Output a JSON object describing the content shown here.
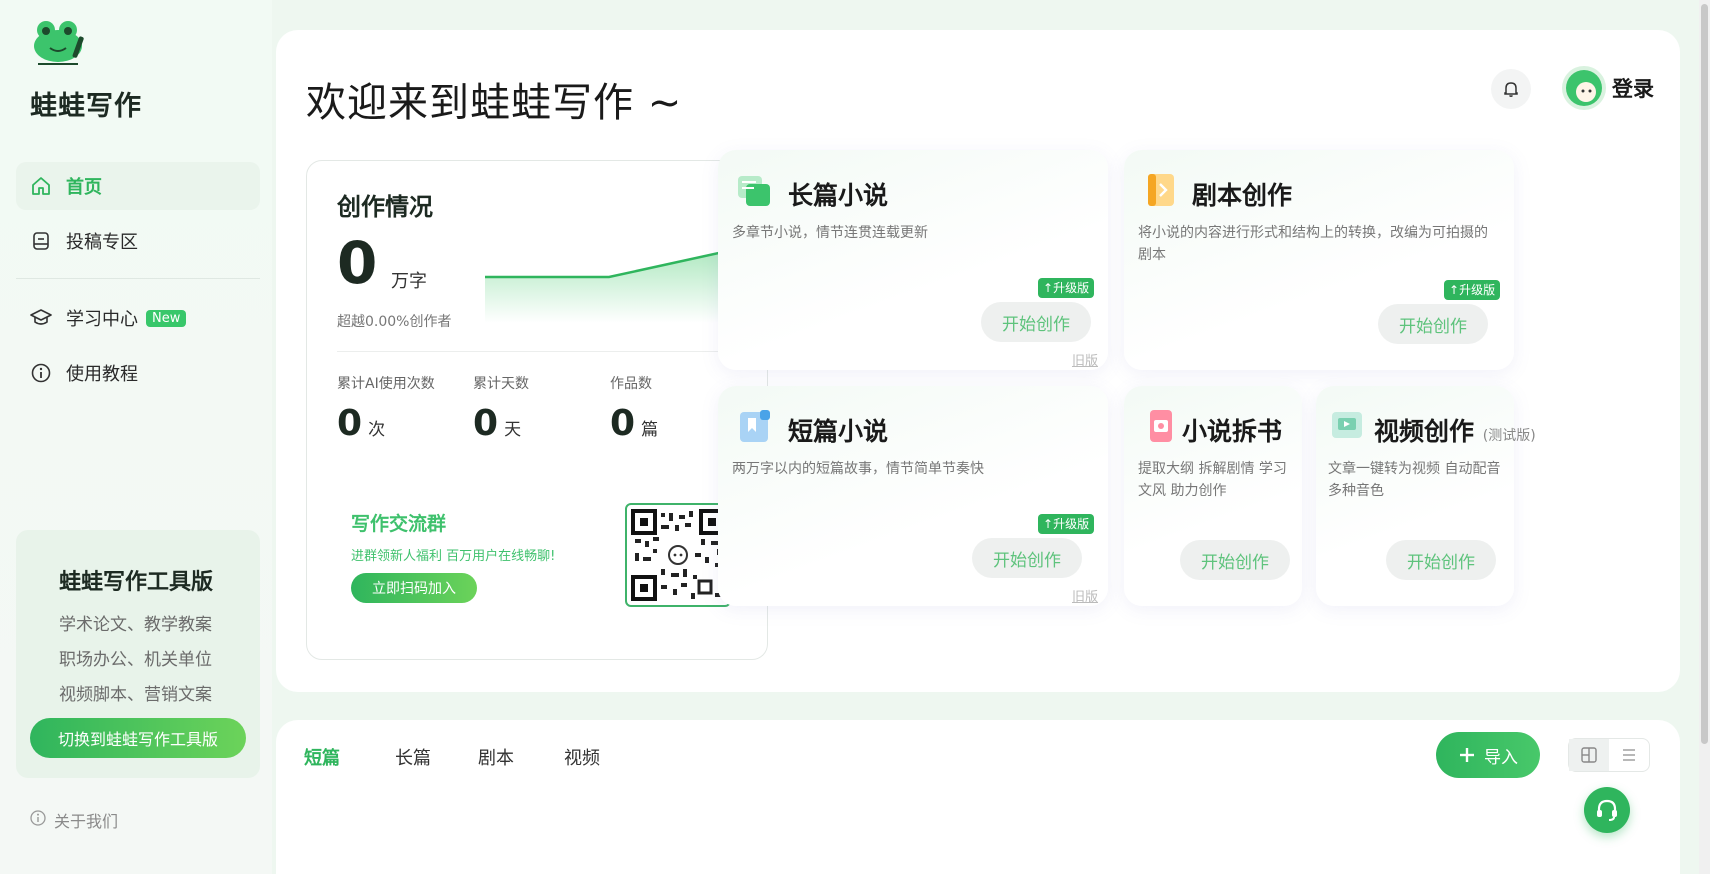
{
  "sidebar": {
    "brand": "蛙蛙写作",
    "nav": [
      {
        "label": "首页",
        "icon": "home-icon",
        "active": true
      },
      {
        "label": "投稿专区",
        "icon": "submission-icon"
      },
      {
        "label": "学习中心",
        "icon": "graduation-cap-icon",
        "badge": "New"
      },
      {
        "label": "使用教程",
        "icon": "info-icon"
      }
    ],
    "promo": {
      "title": "蛙蛙写作工具版",
      "lines": [
        "学术论文、教学教案",
        "职场办公、机关单位",
        "视频脚本、营销文案"
      ],
      "button": "切换到蛙蛙写作工具版"
    },
    "about": "关于我们"
  },
  "header": {
    "welcome": "欢迎来到蛙蛙写作 ~",
    "login": "登录"
  },
  "stats": {
    "title": "创作情况",
    "words": "0",
    "words_unit": "万字",
    "exceed": "超越0.00%创作者",
    "items": [
      {
        "label": "累计AI使用次数",
        "value": "0",
        "unit": "次"
      },
      {
        "label": "累计天数",
        "value": "0",
        "unit": "天"
      },
      {
        "label": "作品数",
        "value": "0",
        "unit": "篇"
      }
    ],
    "group": {
      "title": "写作交流群",
      "subtitle": "进群领新人福利 百万用户在线畅聊!",
      "button": "立即扫码加入"
    }
  },
  "cards": {
    "long_novel": {
      "title": "长篇小说",
      "desc": "多章节小说，情节连贯连载更新",
      "upgrade": "升级版",
      "button": "开始创作",
      "old": "旧版"
    },
    "script": {
      "title": "剧本创作",
      "desc": "将小说的内容进行形式和结构上的转换，改编为可拍摄的剧本",
      "upgrade": "升级版",
      "button": "开始创作"
    },
    "short_novel": {
      "title": "短篇小说",
      "desc": "两万字以内的短篇故事，情节简单节奏快",
      "upgrade": "升级版",
      "button": "开始创作",
      "old": "旧版"
    },
    "breakdown": {
      "title": "小说拆书",
      "desc": "提取大纲 拆解剧情 学习文风 助力创作",
      "button": "开始创作"
    },
    "video": {
      "title": "视频创作",
      "tag": "(测试版)",
      "desc": "文章一键转为视频 自动配音多种音色",
      "button": "开始创作"
    }
  },
  "bottom": {
    "tabs": [
      "短篇",
      "长篇",
      "剧本",
      "视频"
    ],
    "active_tab": 0,
    "import": "导入"
  },
  "colors": {
    "accent": "#2fb55d",
    "accent_light": "#6cd35a"
  }
}
